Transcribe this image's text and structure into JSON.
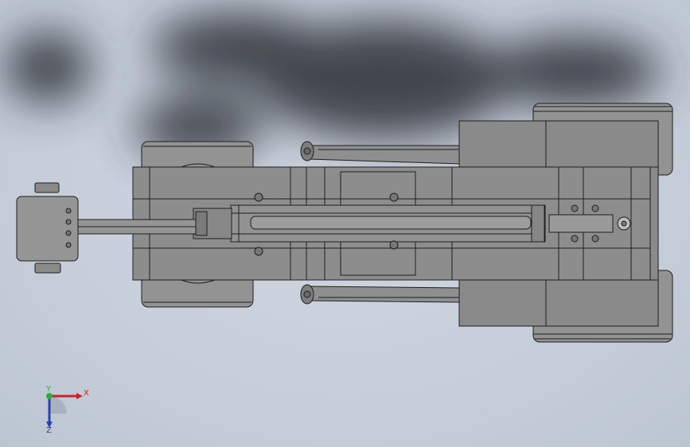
{
  "viewport": {
    "background": "#c7cfdb",
    "shadow_color": "#2b2f36"
  },
  "model": {
    "body_color": "#8c8c8c",
    "body_light": "#9a9a9a",
    "body_dark": "#6f6f6f",
    "edge_color": "#1e1e1e"
  },
  "triad": {
    "x_label": "X",
    "y_label": "Y",
    "z_label": "Z",
    "x_color": "#c8222a",
    "y_color": "#2fae3a",
    "z_color": "#2a3fb0"
  }
}
